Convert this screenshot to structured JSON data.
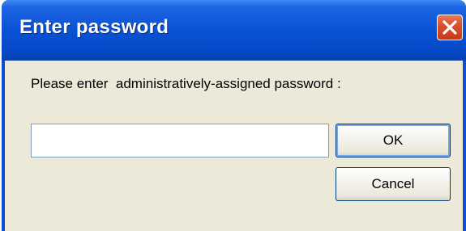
{
  "window": {
    "title": "Enter password",
    "close_icon": "close-icon"
  },
  "dialog": {
    "prompt": "Please enter  administratively-assigned password :",
    "password_value": "",
    "ok_label": "OK",
    "cancel_label": "Cancel"
  },
  "colors": {
    "titlebar": "#0a52d4",
    "client_bg": "#ece9d8",
    "close_button": "#d9512e"
  }
}
